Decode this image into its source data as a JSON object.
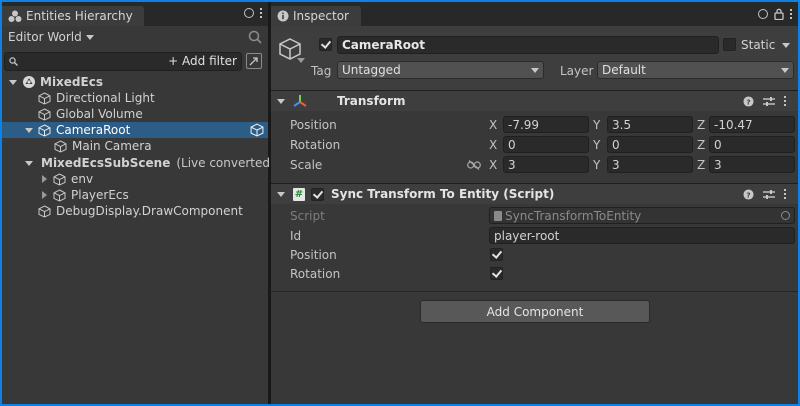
{
  "hierarchy": {
    "tab_title": "Entities Hierarchy",
    "world_selector": "Editor World",
    "add_filter": "+ Add filter",
    "items": [
      {
        "label": "MixedEcs",
        "type": "scene"
      },
      {
        "label": "Directional Light",
        "type": "object"
      },
      {
        "label": "Global Volume",
        "type": "object"
      },
      {
        "label": "CameraRoot",
        "type": "object"
      },
      {
        "label": "Main Camera",
        "type": "object"
      },
      {
        "label": "MixedEcsSubScene",
        "type": "subscene",
        "note": "(Live converted"
      },
      {
        "label": "env",
        "type": "object"
      },
      {
        "label": "PlayerEcs",
        "type": "object"
      },
      {
        "label": "DebugDisplay.DrawComponent",
        "type": "object"
      }
    ]
  },
  "inspector": {
    "tab_title": "Inspector",
    "object_name": "CameraRoot",
    "static_label": "Static",
    "tag_label": "Tag",
    "tag_value": "Untagged",
    "layer_label": "Layer",
    "layer_value": "Default",
    "transform": {
      "title": "Transform",
      "rows": [
        {
          "label": "Position",
          "x": "-7.99",
          "y": "3.5",
          "z": "-10.47"
        },
        {
          "label": "Rotation",
          "x": "0",
          "y": "0",
          "z": "0"
        },
        {
          "label": "Scale",
          "x": "3",
          "y": "3",
          "z": "3"
        }
      ],
      "axis_x": "X",
      "axis_y": "Y",
      "axis_z": "Z"
    },
    "sync_component": {
      "title": "Sync Transform To Entity (Script)",
      "script_label": "Script",
      "script_value": "SyncTransformToEntity",
      "id_label": "Id",
      "id_value": "player-root",
      "position_label": "Position",
      "position_checked": true,
      "rotation_label": "Rotation",
      "rotation_checked": true
    },
    "add_component": "Add Component"
  },
  "colors": {
    "accent_border": "#0b82e6",
    "selection": "#2c5d87",
    "panel": "#383838"
  }
}
